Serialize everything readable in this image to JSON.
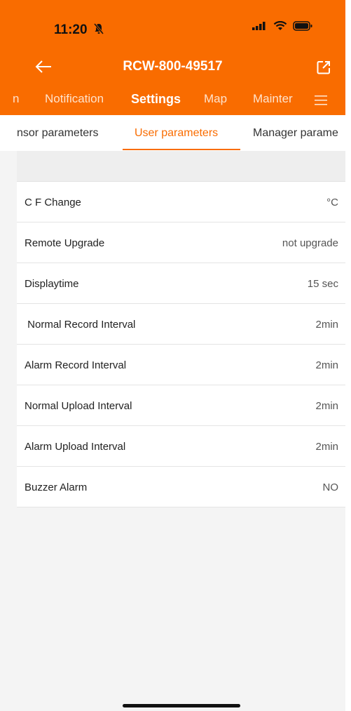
{
  "status_bar": {
    "time": "11:20"
  },
  "header": {
    "title": "RCW-800-49517"
  },
  "tabs": [
    {
      "label": "n"
    },
    {
      "label": "Notification"
    },
    {
      "label": "Settings"
    },
    {
      "label": "Map"
    },
    {
      "label": "Mainter"
    }
  ],
  "subtabs": [
    {
      "label": "nsor parameters"
    },
    {
      "label": "User parameters"
    },
    {
      "label": "Manager parame"
    }
  ],
  "settings": [
    {
      "label": "C F Change",
      "value": "°C"
    },
    {
      "label": "Remote Upgrade",
      "value": "not upgrade"
    },
    {
      "label": "Displaytime",
      "value": "15 sec"
    },
    {
      "label": " Normal Record Interval",
      "value": "2min"
    },
    {
      "label": "Alarm Record Interval",
      "value": "2min"
    },
    {
      "label": "Normal Upload Interval",
      "value": "2min"
    },
    {
      "label": "Alarm Upload Interval",
      "value": "2min"
    },
    {
      "label": "Buzzer Alarm",
      "value": "NO"
    }
  ],
  "colors": {
    "accent": "#f96c00",
    "background": "#f4f4f4",
    "divider": "#e4e4e4"
  },
  "icons": [
    "bell-slash-icon",
    "cellular-signal-icon",
    "wifi-icon",
    "battery-icon",
    "back-arrow-icon",
    "share-icon",
    "menu-icon"
  ]
}
